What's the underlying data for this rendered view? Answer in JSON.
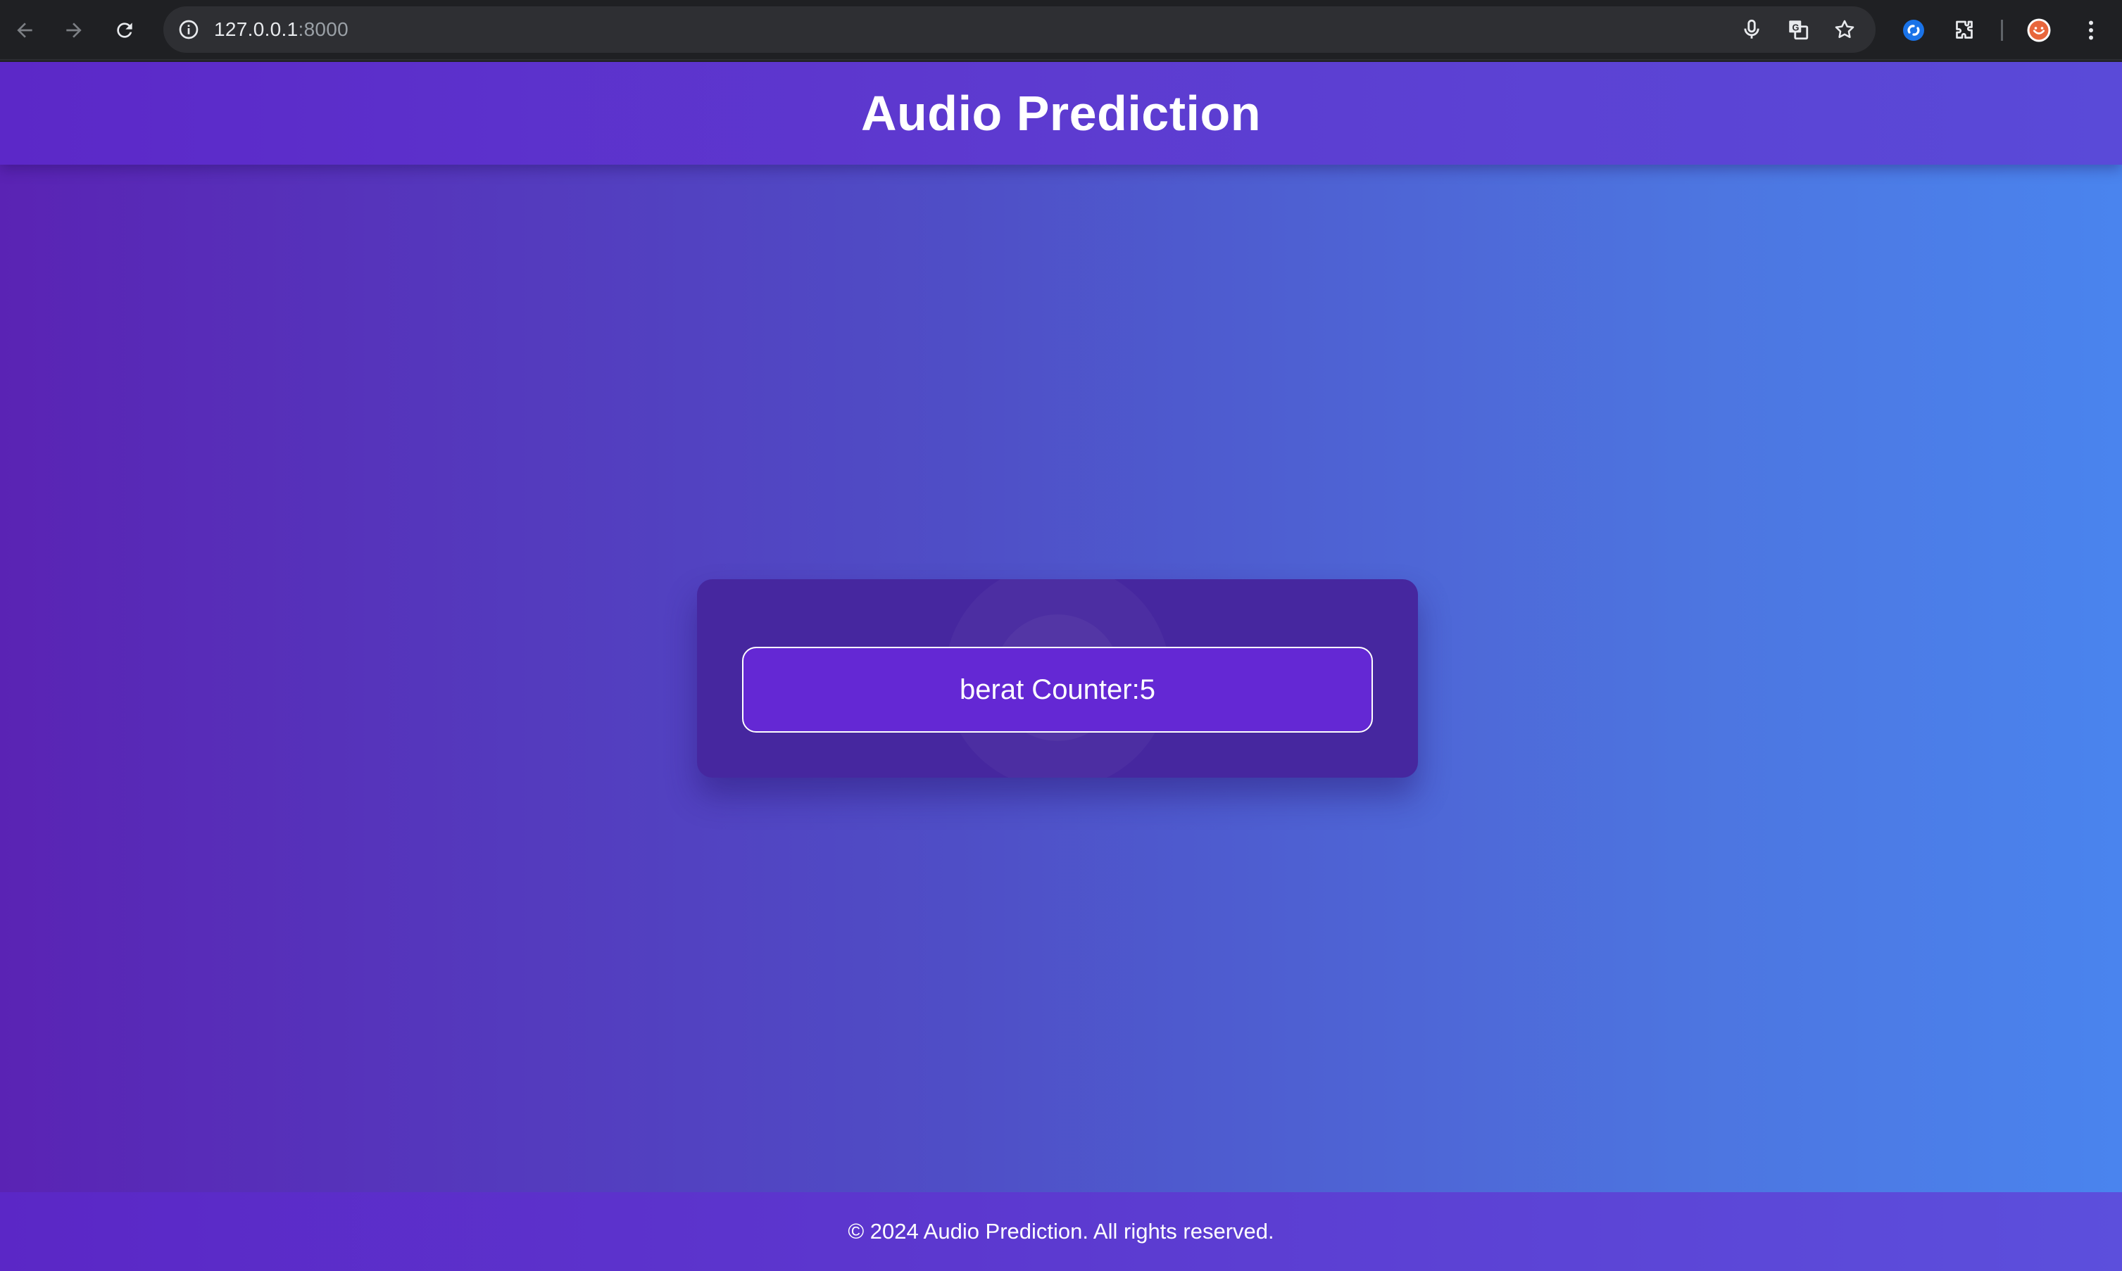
{
  "browser": {
    "url_host": "127.0.0.1",
    "url_port": ":8000",
    "icons": {
      "back": "arrow-left-icon",
      "forward": "arrow-right-icon",
      "reload": "reload-icon",
      "site_info": "info-icon",
      "mic": "microphone-icon",
      "translate": "translate-icon",
      "bookmark": "star-icon",
      "extension_blue": "extension-icon",
      "extensions": "puzzle-icon",
      "profile": "avatar",
      "menu": "kebab-menu-icon"
    }
  },
  "header": {
    "title": "Audio Prediction"
  },
  "card": {
    "counter_label": "berat Counter:5"
  },
  "footer": {
    "text": "© 2024 Audio Prediction. All rights reserved."
  },
  "colors": {
    "chrome_bg": "#1f2023",
    "header_bg": "#5c28c8",
    "card_bg": "#46279f",
    "button_bg": "#6428d4",
    "gradient_start": "#5a23b4",
    "gradient_end": "#4a84ee"
  }
}
